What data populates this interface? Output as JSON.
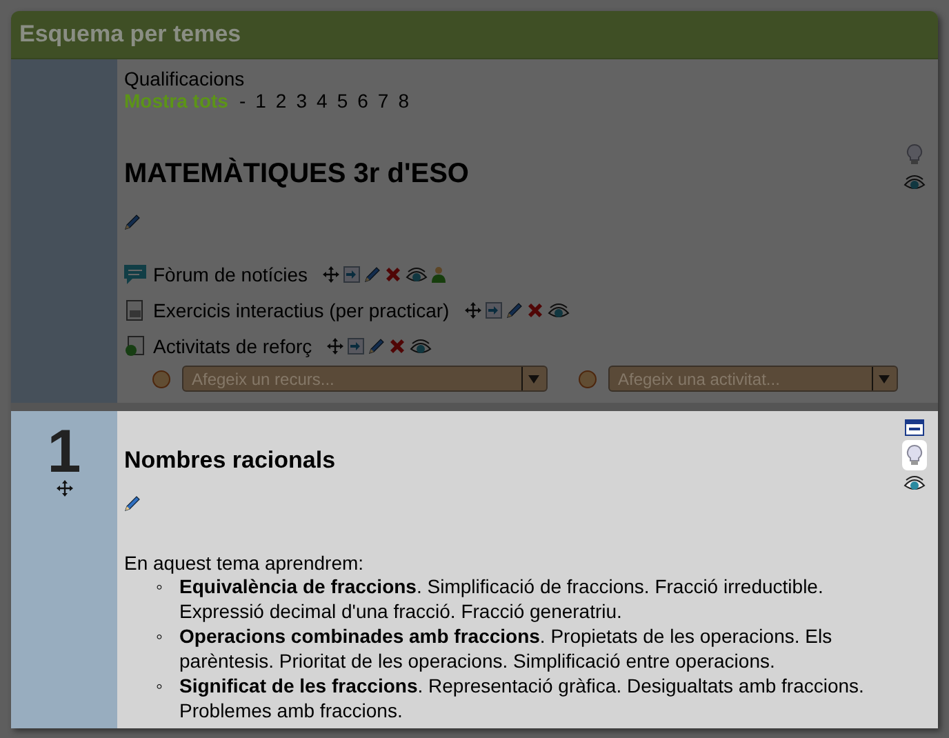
{
  "block": {
    "title": "Esquema per temes"
  },
  "grades": {
    "title": "Qualificacions",
    "show_all": "Mostra tots",
    "separator": "-",
    "sections": [
      "1",
      "2",
      "3",
      "4",
      "5",
      "6",
      "7",
      "8"
    ]
  },
  "sections": [
    {
      "current": false,
      "title": "MATEMÀTIQUES 3r d'ESO",
      "collapsible": false,
      "highlighted": false,
      "activities": [
        {
          "kind": "forum",
          "name": "Fòrum de notícies",
          "groups": true
        },
        {
          "kind": "resource",
          "name": "Exercicis interactius (per practicar)",
          "groups": false
        },
        {
          "kind": "web",
          "name": "Activitats de reforç",
          "groups": false
        }
      ],
      "add_menus": [
        {
          "label": "Afegeix un recurs..."
        },
        {
          "label": "Afegeix una activitat..."
        }
      ]
    },
    {
      "current": true,
      "number": "1",
      "title": "Nombres racionals",
      "collapsible": true,
      "highlighted": true,
      "intro": "En aquest tema aprendrem:",
      "items": [
        {
          "marker": "◦",
          "text": "**Equivalència de fraccions**. Simplificació de fraccions. Fracció irreductible. Expressió decimal d'una fracció. Fracció generatriu."
        },
        {
          "marker": "◦",
          "text": "**Operacions combinades amb fraccions**. Propietats de les operacions. Els parèntesis. Prioritat de les operacions. Simplificació entre operacions."
        },
        {
          "marker": "◦",
          "text": "**Significat de les fraccions**. Representació gràfica. Desigualtats amb fraccions. Problemes amb fraccions."
        }
      ]
    }
  ]
}
